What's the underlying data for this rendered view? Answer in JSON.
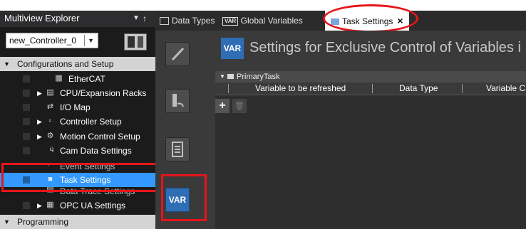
{
  "explorer": {
    "title": "Multiview Explorer",
    "controller": "new_Controller_0",
    "items": [
      {
        "label": "Configurations and Setup",
        "type": "group",
        "icon": "triangle-down"
      },
      {
        "label": "EtherCAT",
        "icon": "ethercat-icon"
      },
      {
        "label": "CPU/Expansion Racks",
        "icon": "rack-icon"
      },
      {
        "label": "I/O Map",
        "icon": "io-map-icon"
      },
      {
        "label": "Controller Setup",
        "icon": "controller-setup-icon"
      },
      {
        "label": "Motion Control Setup",
        "icon": "gear-icon"
      },
      {
        "label": "Cam Data Settings",
        "icon": "cam-icon"
      },
      {
        "label": "Event Settings",
        "icon": "event-icon"
      },
      {
        "label": "Task Settings",
        "icon": "task-icon",
        "selected": true
      },
      {
        "label": "Data Trace Settings",
        "icon": "trace-icon"
      },
      {
        "label": "OPC UA Settings",
        "icon": "opcua-icon"
      },
      {
        "label": "Programming",
        "type": "group",
        "icon": "triangle-down"
      }
    ]
  },
  "tabs": [
    {
      "label": "Data Types",
      "icon": "data-types-icon"
    },
    {
      "label": "Global Variables",
      "icon": "var-icon"
    },
    {
      "label": "Task Settings",
      "icon": "task-icon",
      "active": true
    }
  ],
  "toolbar": {
    "var_label": "VAR"
  },
  "content": {
    "header_icon": "VAR",
    "title": "Settings for Exclusive Control of Variables i",
    "task_group": "PrimaryTask",
    "columns": [
      "Variable to be refreshed",
      "Data Type",
      "Variable C"
    ],
    "add_label": "+",
    "delete_label": "🗑"
  },
  "colors": {
    "accent": "#3399ff",
    "var_blue": "#2f6db5",
    "highlight_red": "#e8141a"
  }
}
